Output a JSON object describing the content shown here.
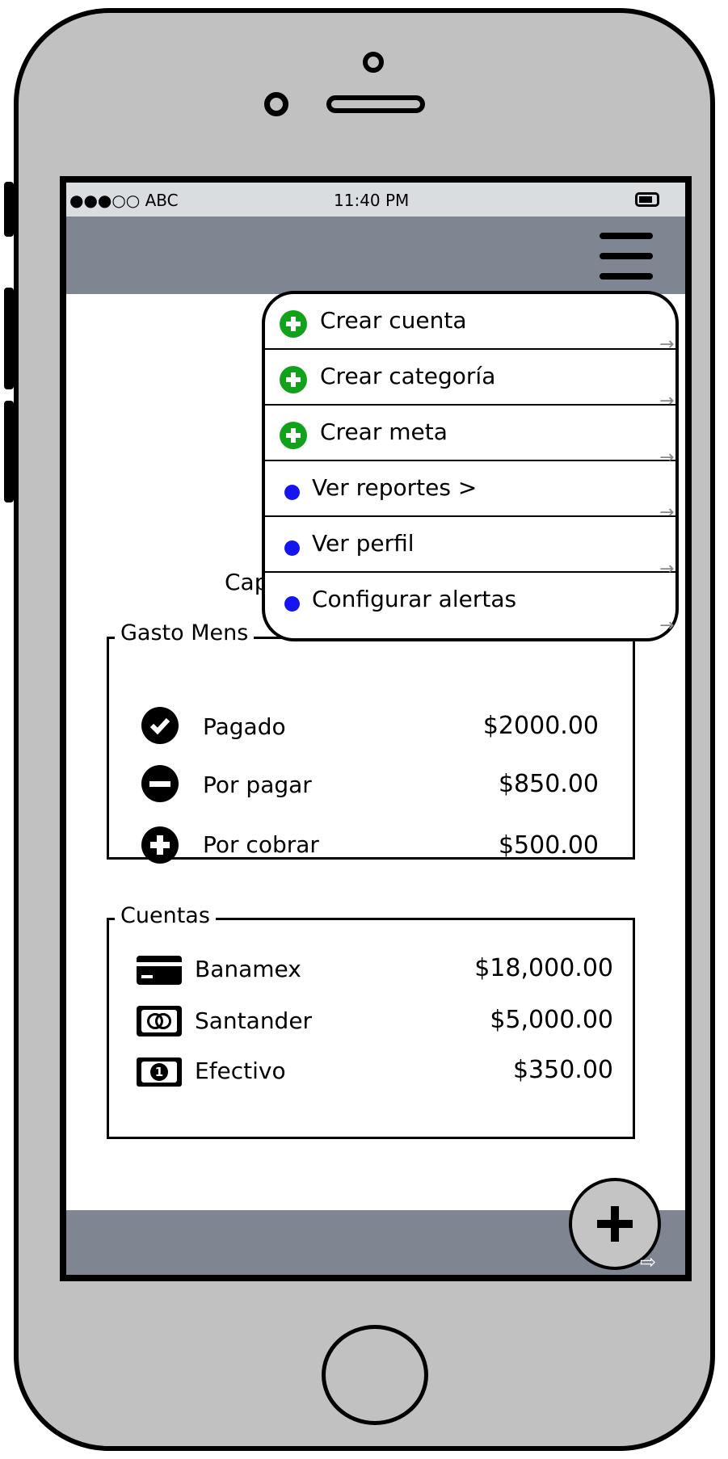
{
  "status_bar": {
    "carrier": "●●●○○ ABC",
    "time": "11:40 PM"
  },
  "main": {
    "partial_text": "Cap"
  },
  "gasto_mensual": {
    "title": "Gasto Mens",
    "rows": [
      {
        "label": "Pagado",
        "value": "$2000.00",
        "icon": "check-circle-icon"
      },
      {
        "label": "Por pagar",
        "value": "$850.00",
        "icon": "minus-circle-icon"
      },
      {
        "label": "Por cobrar",
        "value": "$500.00",
        "icon": "plus-circle-icon"
      }
    ]
  },
  "cuentas": {
    "title": "Cuentas",
    "rows": [
      {
        "label": "Banamex",
        "value": "$18,000.00",
        "icon": "credit-card-icon"
      },
      {
        "label": "Santander",
        "value": "$5,000.00",
        "icon": "mastercard-icon"
      },
      {
        "label": "Efectivo",
        "value": "$350.00",
        "icon": "cash-icon"
      }
    ]
  },
  "menu": {
    "items": [
      {
        "label": "Crear cuenta",
        "icon": "plus-circle-green-icon"
      },
      {
        "label": "Crear categoría",
        "icon": "plus-circle-green-icon"
      },
      {
        "label": "Crear meta",
        "icon": "plus-circle-green-icon"
      },
      {
        "label": "Ver reportes >",
        "icon": "blue-dot-icon"
      },
      {
        "label": "Ver perfil",
        "icon": "blue-dot-icon"
      },
      {
        "label": "Configurar alertas",
        "icon": "blue-dot-icon"
      }
    ]
  },
  "fab": {
    "icon": "plus-icon"
  },
  "colors": {
    "appbar": "#7f8692",
    "phone_body": "#c1c1c1",
    "menu_plus": "#12a11a",
    "menu_dot": "#1515f0"
  }
}
